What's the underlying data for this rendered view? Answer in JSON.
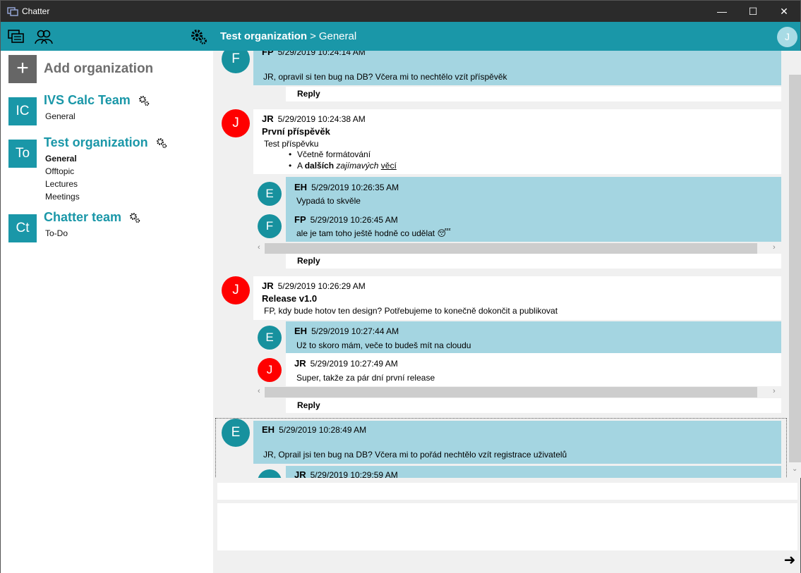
{
  "window": {
    "title": "Chatter",
    "minimize": "—",
    "maximize": "☐",
    "close": "✕"
  },
  "header": {
    "org": "Test organization",
    "separator": ">",
    "channel": "General",
    "user_initial": "J"
  },
  "sidebar": {
    "add_label": "Add organization",
    "add_symbol": "+",
    "orgs": [
      {
        "initials": "IC",
        "name": "IVS Calc Team",
        "channels": [
          "General"
        ]
      },
      {
        "initials": "To",
        "name": "Test organization",
        "channels": [
          "General",
          "Offtopic",
          "Lectures",
          "Meetings"
        ]
      },
      {
        "initials": "Ct",
        "name": "Chatter team",
        "channels": [
          "To-Do"
        ]
      }
    ]
  },
  "messages": {
    "m0": {
      "avatar": "F",
      "author": "FP",
      "time": "5/29/2019 10:24:14 AM",
      "text": "JR, opravil si ten bug na DB? Včera mi to nechtělo vzít příspěvěk"
    },
    "m1": {
      "avatar": "J",
      "author": "JR",
      "time": "5/29/2019 10:24:38 AM",
      "title": "První příspěvěk",
      "text": "Test příspěvku",
      "bullet1": "Včetně formátování",
      "bullet2_a": "A ",
      "bullet2_b": "dalších",
      "bullet2_c": "zajímavých",
      "bullet2_d": "věcí"
    },
    "m1r1": {
      "avatar": "E",
      "author": "EH",
      "time": "5/29/2019 10:26:35 AM",
      "text": "Vypadá to skvěle"
    },
    "m1r2": {
      "avatar": "F",
      "author": "FP",
      "time": "5/29/2019 10:26:45 AM",
      "text": "ale je tam toho ještě hodně co udělat 😴"
    },
    "m2": {
      "avatar": "J",
      "author": "JR",
      "time": "5/29/2019 10:26:29 AM",
      "title": "Release v1.0",
      "text": "FP, kdy bude hotov ten design? Potřebujeme to konečně dokončit a publikovat"
    },
    "m2r1": {
      "avatar": "E",
      "author": "EH",
      "time": "5/29/2019 10:27:44 AM",
      "text": "Už to skoro mám, veče to budeš mít na cloudu"
    },
    "m2r2": {
      "avatar": "J",
      "author": "JR",
      "time": "5/29/2019 10:27:49 AM",
      "text": "Super, takže za pár dní první release"
    },
    "m3": {
      "avatar": "E",
      "author": "EH",
      "time": "5/29/2019 10:28:49 AM",
      "text": "JR, Oprail jsi ten bug na DB? Včera mi to pořád nechtělo vzít registrace uživatelů"
    },
    "m3r1": {
      "author": "JR",
      "time": "5/29/2019 10:29:59 AM"
    }
  },
  "reply_label": "Reply",
  "send_symbol": "➜",
  "icons": {
    "chats": "chats-icon",
    "people": "people-icon",
    "settings": "gear-icon",
    "org_settings": "gear-icon",
    "send": "arrow-right-icon"
  },
  "colors": {
    "accent": "#1a97a8",
    "reply_bg": "#a4d5e1",
    "avatar_red": "#ff0000",
    "avatar_teal": "#17919e"
  }
}
